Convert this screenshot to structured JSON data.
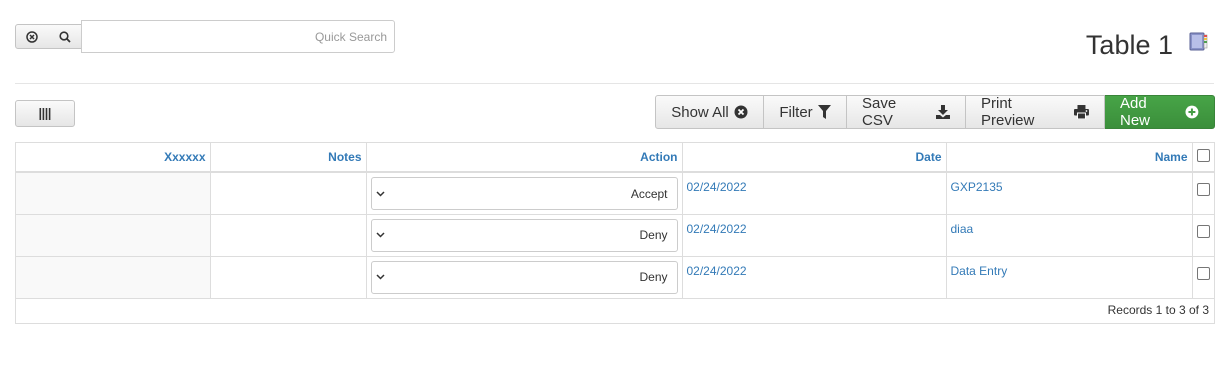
{
  "search": {
    "placeholder": "Quick Search",
    "value": "",
    "clear_icon": "clear-circle-icon",
    "search_icon": "magnifier-icon"
  },
  "header": {
    "title": "Table 1",
    "book_icon": "book-icon"
  },
  "toolbar": {
    "columns_icon": "columns-icon",
    "show_all_label": "Show All",
    "filter_label": "Filter",
    "save_csv_label": "Save CSV",
    "print_preview_label": "Print Preview",
    "add_new_label": "Add New",
    "add_new_color": "#449d44",
    "link_color": "#337ab7"
  },
  "table": {
    "columns": [
      "Xxxxxx",
      "Notes",
      "Action",
      "Date",
      "Name"
    ],
    "rows": [
      {
        "xxxxxx": "",
        "notes": "",
        "action": "Accept",
        "date": "02/24/2022",
        "name": "GXP2135",
        "selected": false
      },
      {
        "xxxxxx": "",
        "notes": "",
        "action": "Deny",
        "date": "02/24/2022",
        "name": "diaa",
        "selected": false
      },
      {
        "xxxxxx": "",
        "notes": "",
        "action": "Deny",
        "date": "02/24/2022",
        "name": "Data Entry",
        "selected": false
      }
    ],
    "records_info": "Records 1 to 3 of 3"
  }
}
